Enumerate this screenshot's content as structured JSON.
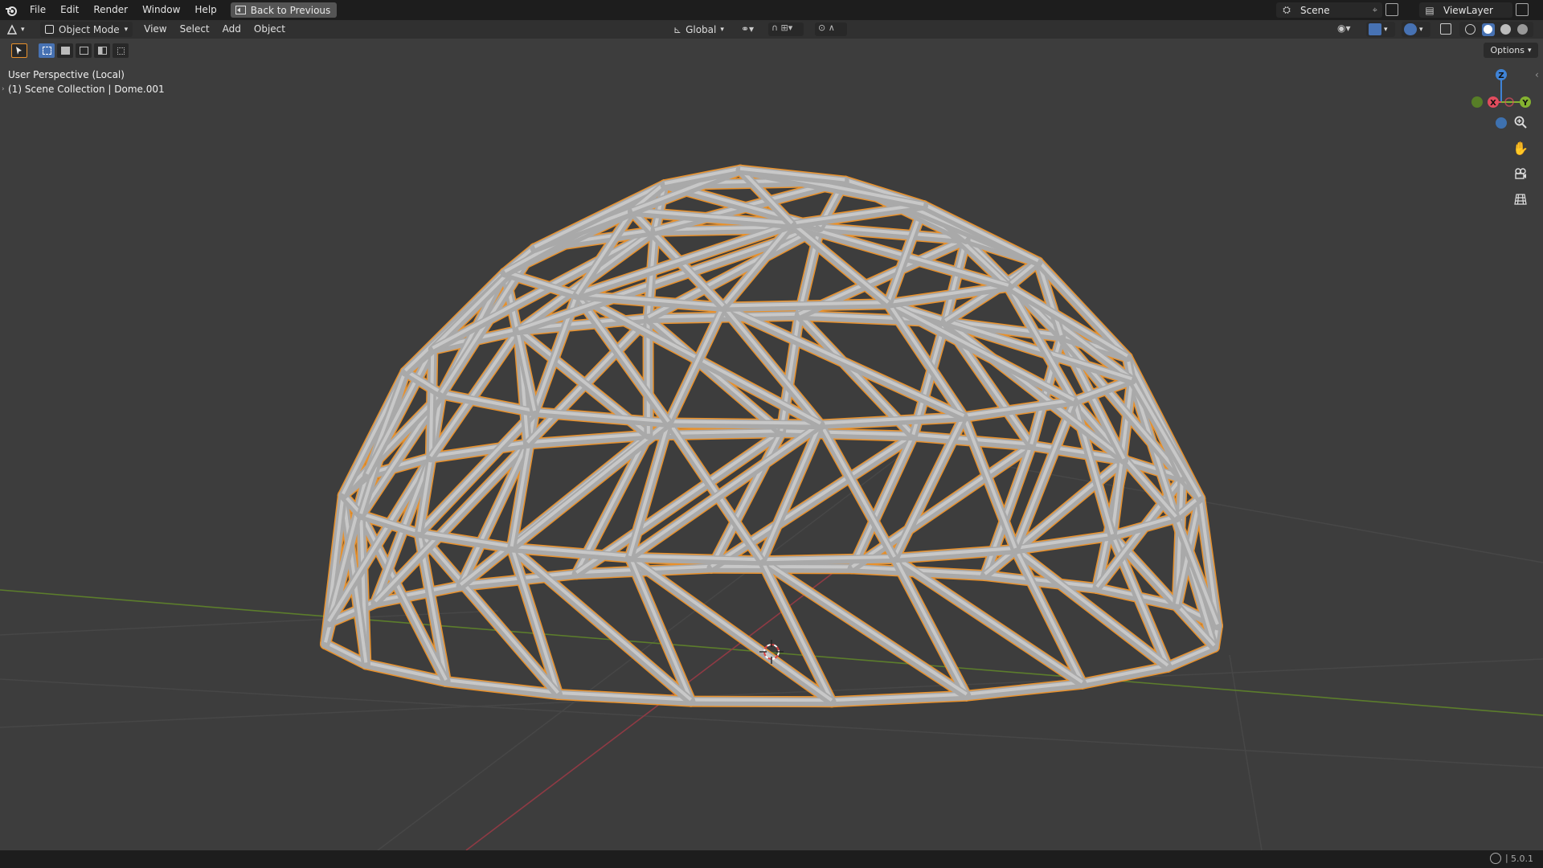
{
  "topbar": {
    "menu": [
      "File",
      "Edit",
      "Render",
      "Window",
      "Help"
    ],
    "back_button": "Back to Previous",
    "scene": "Scene",
    "view_layer": "ViewLayer"
  },
  "header": {
    "mode": "Object Mode",
    "menus": [
      "View",
      "Select",
      "Add",
      "Object"
    ],
    "transform_orientation": "Global",
    "options": "Options"
  },
  "viewport": {
    "perspective": "User Perspective (Local)",
    "collection": "(1) Scene Collection | Dome.001",
    "gizmo": {
      "x": "X",
      "y": "Y",
      "z": "Z"
    }
  },
  "statusbar": {
    "version": "5.0.1"
  },
  "colors": {
    "selection": "#e8912c",
    "strut": "#a9a9a9",
    "x_axis": "#e34c5e",
    "y_axis": "#84b230",
    "z_axis": "#3f83d6",
    "background": "#3d3d3d"
  },
  "icons": [
    "blender-logo",
    "back-icon",
    "select-box-icon",
    "zoom-icon",
    "hand-icon",
    "camera-icon",
    "grid-icon",
    "cursor-icon"
  ]
}
